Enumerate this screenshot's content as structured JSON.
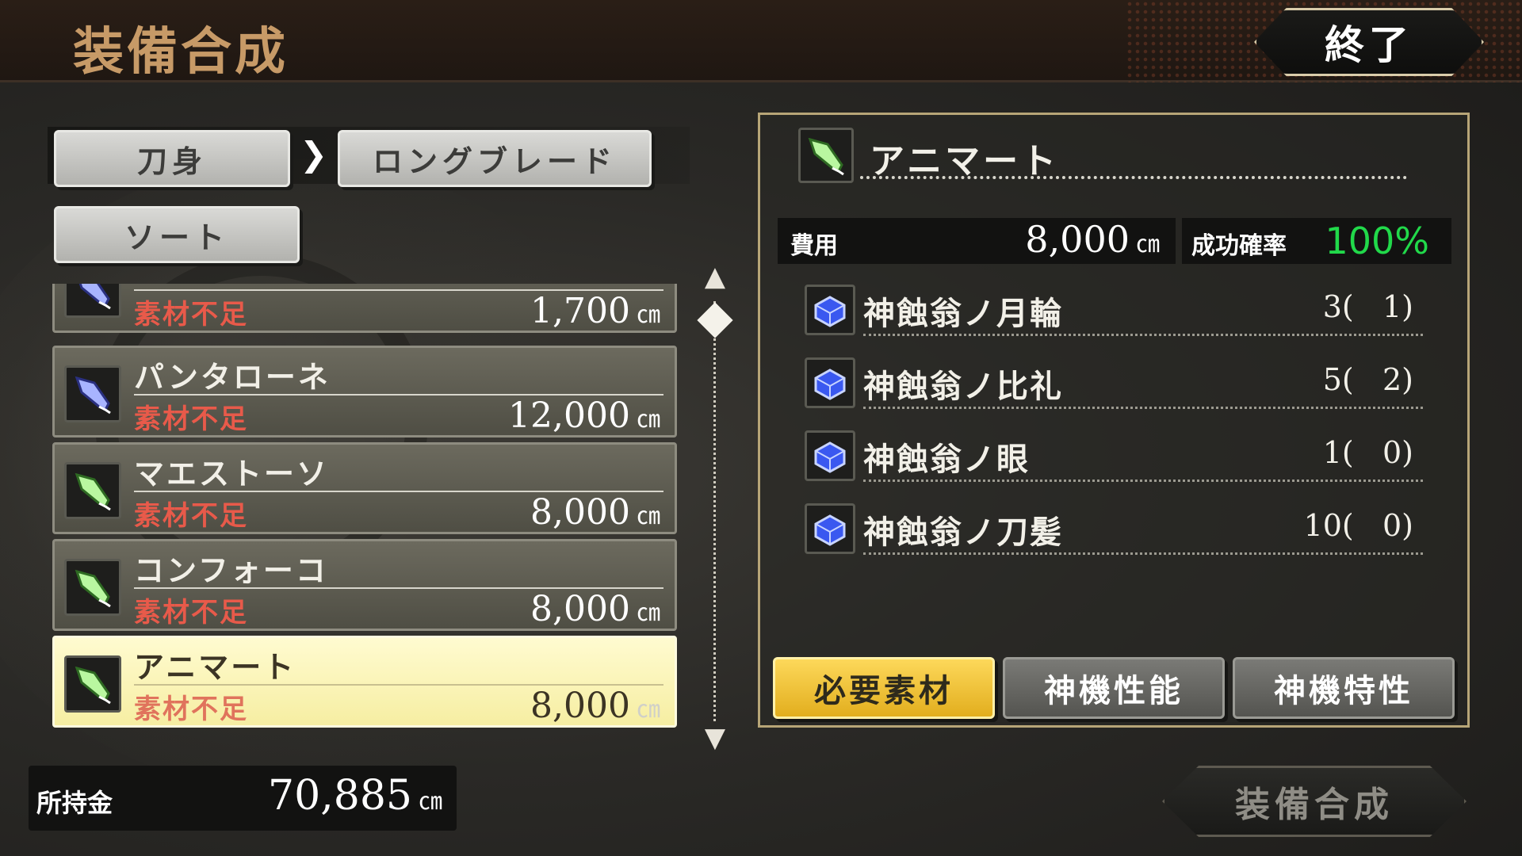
{
  "header": {
    "title": "装備合成",
    "close_label": "終了"
  },
  "category": {
    "primary": "刀身",
    "secondary": "ロングブレード",
    "sort_label": "ソート",
    "separator": "❯"
  },
  "currency_unit": "㎝",
  "list": {
    "items": [
      {
        "name": "",
        "status": "素材不足",
        "price": "1,700",
        "icon": "sword-icon-blue"
      },
      {
        "name": "パンタローネ",
        "status": "素材不足",
        "price": "12,000",
        "icon": "sword-icon-blue"
      },
      {
        "name": "マエストーソ",
        "status": "素材不足",
        "price": "8,000",
        "icon": "sword-icon-green"
      },
      {
        "name": "コンフォーコ",
        "status": "素材不足",
        "price": "8,000",
        "icon": "sword-icon-green"
      },
      {
        "name": "アニマート",
        "status": "素材不足",
        "price": "8,000",
        "icon": "sword-icon-green",
        "selected": true
      }
    ]
  },
  "money": {
    "label": "所持金",
    "value": "70,885"
  },
  "detail": {
    "name": "アニマート",
    "cost_label": "費用",
    "cost_value": "8,000",
    "rate_label": "成功確率",
    "rate_value": "100%",
    "materials": [
      {
        "name": "神蝕翁ノ月輪",
        "count": "3(   1)"
      },
      {
        "name": "神蝕翁ノ比礼",
        "count": "5(   2)"
      },
      {
        "name": "神蝕翁ノ眼",
        "count": "1(   0)"
      },
      {
        "name": "神蝕翁ノ刀髪",
        "count": "10(   0)"
      }
    ],
    "tabs": [
      "必要素材",
      "神機性能",
      "神機特性"
    ]
  },
  "synth_button": "装備合成",
  "colors": {
    "accent_gold": "#e2ae1e",
    "rate_green": "#21d94a",
    "warning_red": "#e85a4a"
  }
}
